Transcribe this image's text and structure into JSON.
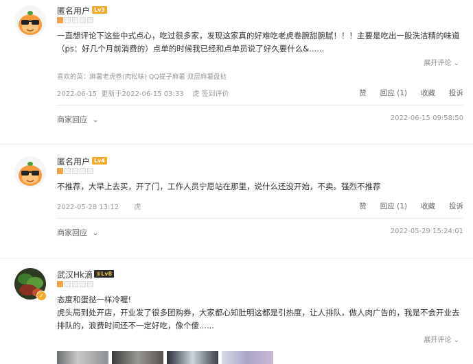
{
  "reviews": [
    {
      "user": "匿名用户",
      "level": "Lv3",
      "rating": 1,
      "text": "一直想评论下这些中式点心，吃过很多家，发现这家真的好难吃老虎卷腕甜腕腻！！！主要是吃出一股洗洁精的味道（ps：好几个月前消费的）点单的时候我已经和点单员说了好久要什么&......",
      "expand": "展开评论",
      "tags": "喜欢的菜：麻薯老虎卷(肉松味) QQ提子麻薯 双层麻薯盘挞",
      "date": "2022-06-15",
      "updated": "更新于2022-06-15 03:33",
      "signin": "虎 签到评价",
      "actions": {
        "like": "赞",
        "reply": "回应 (1)",
        "fav": "收藏",
        "report": "投诉"
      },
      "merchant": "商家回应",
      "merchant_date": "2022-06-15 09:58:50"
    },
    {
      "user": "匿名用户",
      "level": "Lv4",
      "rating": 1,
      "text": "不推荐，大早上去买，开了门，工作人员宁愿站在那里，说什么还没开始，不卖。强烈不推荐",
      "date": "2022-05-28 13:12",
      "signin": "虎",
      "actions": {
        "like": "赞",
        "reply": "回应 (1)",
        "fav": "收藏",
        "report": "投诉"
      },
      "merchant": "商家回应",
      "merchant_date": "2022-05-29 15:24:01"
    },
    {
      "user": "武汉Hk滴",
      "level": "Lv8",
      "rating": 1,
      "text1": "态度和蛋挞一样冷喔!",
      "text2": "虎头局到处开店，开业发了很多团购券，大家都心知肚明这都是引热度，让人排队，做人肉广告的，我是不会开业去排队的，浪费时间还不一定好吃，像个傻......",
      "expand": "展开评论"
    }
  ],
  "colors": {
    "level_badge": "#f3a92a",
    "star_on": "#f4a04a",
    "star_off": "#f2f2f2"
  }
}
